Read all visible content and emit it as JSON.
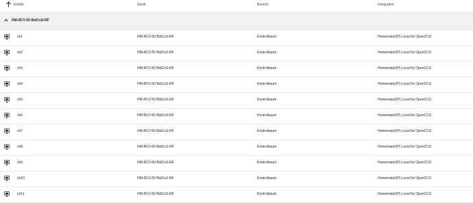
{
  "columns": {
    "entity": "Entität",
    "device": "Gerät",
    "area": "Bereich",
    "integration": "Integration"
  },
  "group": {
    "label": "HM-RCV-50 BidCoS-RF"
  },
  "rows": [
    {
      "entity": "ch1",
      "device": "HM-RCV-50 BidCoS-RF",
      "area": "Kontrollraum",
      "integration": "Homematic(IP) Local for OpenCCU"
    },
    {
      "entity": "ch2",
      "device": "HM-RCV-50 BidCoS-RF",
      "area": "Kontrollraum",
      "integration": "Homematic(IP) Local for OpenCCU"
    },
    {
      "entity": "ch3",
      "device": "HM-RCV-50 BidCoS-RF",
      "area": "Kontrollraum",
      "integration": "Homematic(IP) Local for OpenCCU"
    },
    {
      "entity": "ch4",
      "device": "HM-RCV-50 BidCoS-RF",
      "area": "Kontrollraum",
      "integration": "Homematic(IP) Local for OpenCCU"
    },
    {
      "entity": "ch5",
      "device": "HM-RCV-50 BidCoS-RF",
      "area": "Kontrollraum",
      "integration": "Homematic(IP) Local for OpenCCU"
    },
    {
      "entity": "ch6",
      "device": "HM-RCV-50 BidCoS-RF",
      "area": "Kontrollraum",
      "integration": "Homematic(IP) Local for OpenCCU"
    },
    {
      "entity": "ch7",
      "device": "HM-RCV-50 BidCoS-RF",
      "area": "Kontrollraum",
      "integration": "Homematic(IP) Local for OpenCCU"
    },
    {
      "entity": "ch8",
      "device": "HM-RCV-50 BidCoS-RF",
      "area": "Kontrollraum",
      "integration": "Homematic(IP) Local for OpenCCU"
    },
    {
      "entity": "ch9",
      "device": "HM-RCV-50 BidCoS-RF",
      "area": "Kontrollraum",
      "integration": "Homematic(IP) Local for OpenCCU"
    },
    {
      "entity": "ch10",
      "device": "HM-RCV-50 BidCoS-RF",
      "area": "Kontrollraum",
      "integration": "Homematic(IP) Local for OpenCCU"
    },
    {
      "entity": "ch11",
      "device": "HM-RCV-50 BidCoS-RF",
      "area": "Kontrollraum",
      "integration": "Homematic(IP) Local for OpenCCU"
    }
  ],
  "icons": {
    "sort": "arrow-up-icon",
    "group_toggle": "chevron-up-icon",
    "row": "remote-button-icon"
  }
}
